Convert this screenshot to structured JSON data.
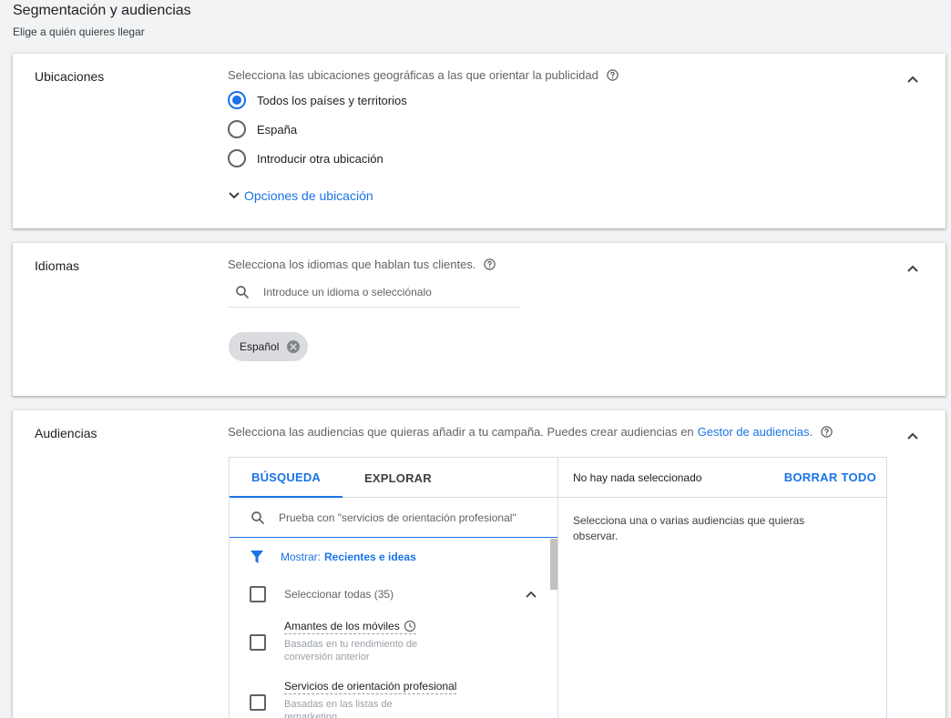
{
  "header": {
    "title": "Segmentación y audiencias",
    "subtitle": "Elige a quién quieres llegar"
  },
  "locations": {
    "label": "Ubicaciones",
    "description": "Selecciona las ubicaciones geográficas a las que orientar la publicidad",
    "options": [
      {
        "label": "Todos los países y territorios",
        "selected": true
      },
      {
        "label": "España",
        "selected": false
      },
      {
        "label": "Introducir otra ubicación",
        "selected": false
      }
    ],
    "options_link": "Opciones de ubicación"
  },
  "languages": {
    "label": "Idiomas",
    "description": "Selecciona los idiomas que hablan tus clientes.",
    "search_placeholder": "Introduce un idioma o selecciónalo",
    "chips": [
      "Español"
    ]
  },
  "audiences": {
    "label": "Audiencias",
    "description": "Selecciona las audiencias que quieras añadir a tu campaña. Puedes crear audiencias en",
    "manager_link": "Gestor de audiencias",
    "tabs": [
      {
        "label": "BÚSQUEDA",
        "active": true
      },
      {
        "label": "EXPLORAR",
        "active": false
      }
    ],
    "search_placeholder": "Prueba con \"servicios de orientación profesional\"",
    "filter_label": "Mostrar:",
    "filter_value": "Recientes e ideas",
    "select_all": "Seleccionar todas (35)",
    "items": [
      {
        "name": "Amantes de los móviles",
        "subtitle": "Basadas en tu rendimiento de conversión anterior"
      },
      {
        "name": "Servicios de orientación profesional",
        "subtitle": "Basadas en las listas de remarketing"
      }
    ],
    "selected_header": "No hay nada seleccionado",
    "clear_all": "BORRAR TODO",
    "empty_message": "Selecciona una o varias audiencias que quieras observar."
  },
  "colors": {
    "accent": "#1a73e8",
    "text": "#202124",
    "muted": "#5f6368",
    "background": "#f1f3f4"
  }
}
